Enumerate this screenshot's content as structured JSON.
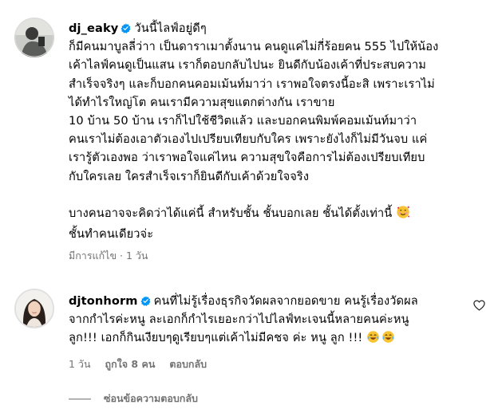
{
  "comment1": {
    "username": "dj_eaky",
    "caption": "วันนี้ไลฟ์อยู่ดีๆ",
    "lines": [
      "ก็มีคนมาบูลลี่ว่าา เป็นดาราเมาตั้งนาน คนดูแค่ไม่กี่ร้อยคน 555 ไปให้น้อง",
      "เค้าไลฟ์คนดูเป็นแสน เราก็ตอบกลับไปนะ ยินดีกับน้องเค้าที่ประสบความ",
      "สำเร็จจริงๆ และก็บอกคนคอมเม้นท์มาว่า เราพอใจตรงนี้อะสิ เพราะเราไม่",
      "ได้ทำไรใหญ่โต คนเรามีความสุขแตกต่างกัน เราขาย",
      "10 บ้าน 50 บ้าน เราก็ไปใช้ชีวิตแล้ว และบอกคนพิมพ์คอมเม้นท์มาว่า",
      "คนเราไม่ต้องเอาตัวเองไปเปรียบเทียบกับใคร เพราะยังไงก็ไม่มีวันจบ แค่",
      "เรารู้ตัวเองพอ ว่าเราพอใจแค่ไหน ความสุขใจคือการไม่ต้องเปรียบเทียบ",
      "กับใครเลย ใครสำเร็จเราก็ยินดีกับเค้าด้วยใจจริง"
    ],
    "lines2a": "บางคนอาจจะคิดว่าได้แค่นี้ สำหรับชั้น ชั้นบอกเลย ชั้นได้ตั้งเท่านี้",
    "lines2b": "ชั้นทำคนเดียวจ่ะ",
    "edited": "มีการแก้ไข",
    "dot": "·",
    "time": "1 วัน"
  },
  "comment2": {
    "username": "djtonhorm",
    "line1": "คนที่ไม่รู้เรื่องธุรกิจวัดผลจากยอดขาย คนรู้เรื่องวัดผล",
    "line2": "จากกำไรค่ะหนู ละเอกก็กำไรเยอะกว่าไปไลฟ์ทะเจนนี้หลายคนค่ะหนู",
    "line3": "ลูก!!! เอกก็กินเงียบๆดูเรียบๆแต่เค้าไม่มีคชจ ค่ะ หนู ลูก !!!",
    "time": "1 วัน",
    "likes": "ถูกใจ 8 คน",
    "reply": "ตอบกลับ"
  },
  "view_replies": "ซ่อนข้อความตอบกลับ",
  "icons": {
    "verified": "verified-badge-icon",
    "heart": "heart-outline-icon",
    "emoji_love": "smiling-face-with-hearts",
    "emoji_laugh": "face-with-tears-of-joy"
  },
  "colors": {
    "verified": "#0095f6",
    "secondary_text": "#737373"
  }
}
